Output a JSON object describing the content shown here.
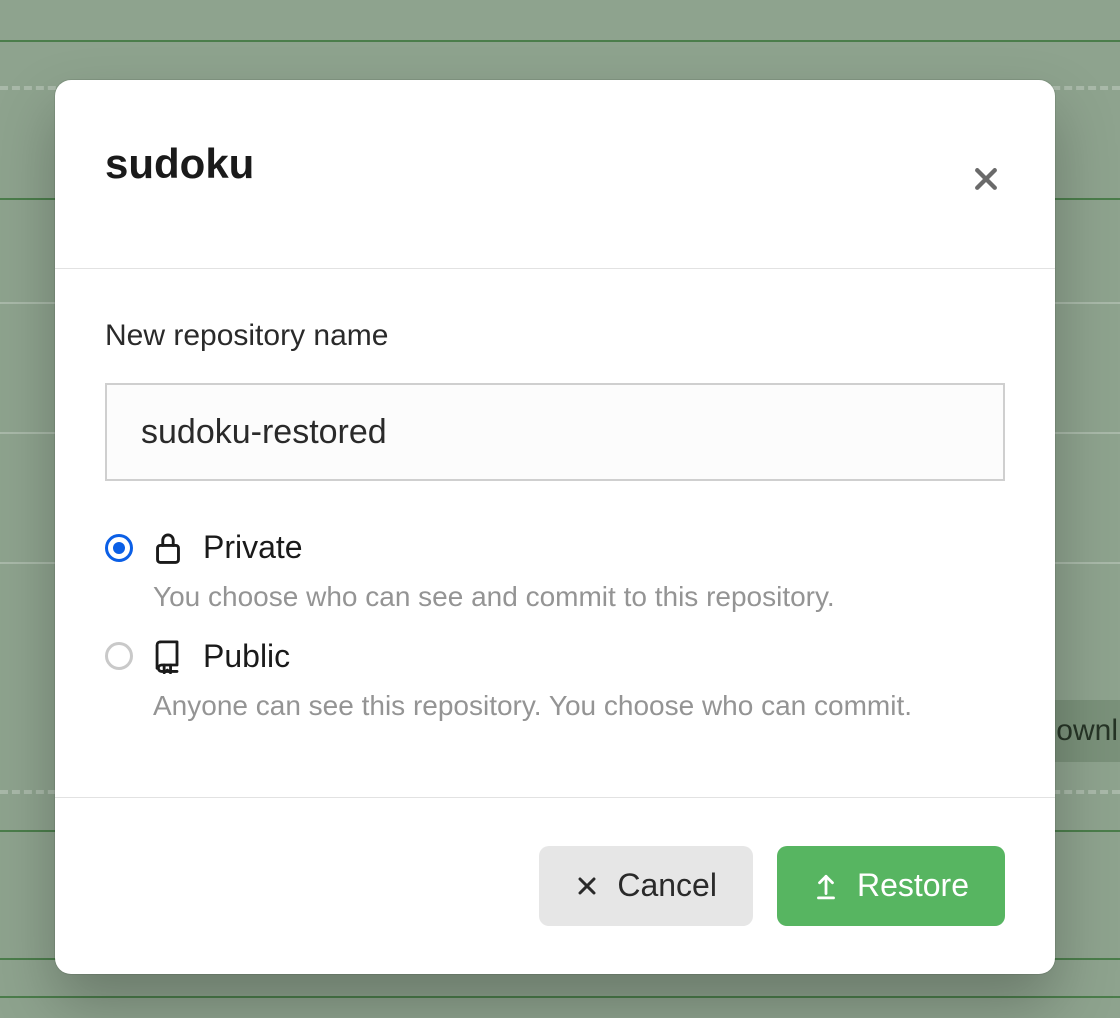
{
  "modal": {
    "title": "sudoku",
    "nameField": {
      "label": "New repository name",
      "value": "sudoku-restored"
    },
    "visibility": {
      "private": {
        "label": "Private",
        "description": "You choose who can see and commit to this repository.",
        "selected": true
      },
      "public": {
        "label": "Public",
        "description": "Anyone can see this repository. You choose who can commit.",
        "selected": false
      }
    },
    "actions": {
      "cancel": "Cancel",
      "restore": "Restore"
    }
  },
  "background": {
    "partial_button_text": "ownl"
  }
}
